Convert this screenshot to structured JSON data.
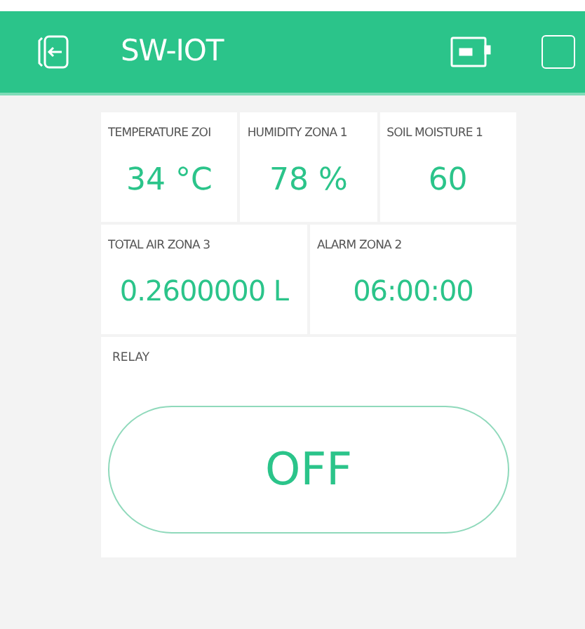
{
  "header": {
    "title": "SW-IOT"
  },
  "rows": [
    [
      {
        "label": "TEMPERATURE ZOI",
        "value": "34 °C"
      },
      {
        "label": "HUMIDITY ZONA 1",
        "value": "78 %"
      },
      {
        "label": "SOIL MOISTURE 1",
        "value": "60"
      }
    ],
    [
      {
        "label": "TOTAL AIR ZONA 3",
        "value": "0.2600000 L"
      },
      {
        "label": "ALARM ZONA 2",
        "value": "06:00:00"
      }
    ]
  ],
  "relay": {
    "label": "RELAY",
    "button": "OFF",
    "on": false
  }
}
